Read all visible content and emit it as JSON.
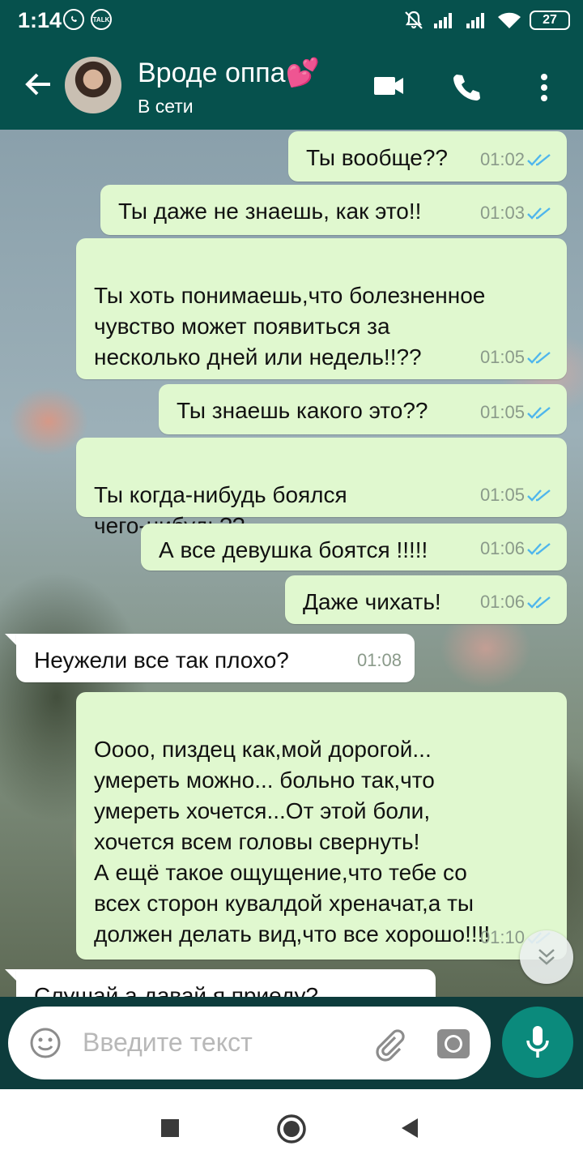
{
  "status_bar": {
    "time": "1:14",
    "talk_badge": "TALK",
    "battery": "27"
  },
  "header": {
    "contact_name": "Вроде оппа💕",
    "contact_status": "В сети"
  },
  "messages": [
    {
      "text": "Ты вообще??",
      "time": "01:02",
      "direction": "out"
    },
    {
      "text": "Ты даже не знаешь, как это!!",
      "time": "01:03",
      "direction": "out"
    },
    {
      "text": "Ты хоть понимаешь,что болезненное\nчувство может появиться за\nнесколько дней или недель!!??",
      "time": "01:05",
      "direction": "out"
    },
    {
      "text": "Ты знаешь какого это??",
      "time": "01:05",
      "direction": "out"
    },
    {
      "text": "Ты когда-нибудь боялся\nчего-нибудь??",
      "time": "01:05",
      "direction": "out"
    },
    {
      "text": "А все девушка боятся !!!!!",
      "time": "01:06",
      "direction": "out"
    },
    {
      "text": "Даже чихать!",
      "time": "01:06",
      "direction": "out"
    },
    {
      "text": "Неужели все так плохо?",
      "time": "01:08",
      "direction": "in"
    },
    {
      "text": "Оооо, пиздец как,мой дорогой...\nумереть можно... больно так,что\nумереть хочется...От этой боли,\nхочется всем головы свернуть!\nА ещё такое ощущение,что тебе со\nвсех сторон кувалдой хреначат,а ты\nдолжен делать вид,что все хорошо!!!!",
      "time": "01:10",
      "direction": "out"
    },
    {
      "text": "Слушай,а давай я приеду?",
      "time": "",
      "direction": "in"
    }
  ],
  "input": {
    "placeholder": "Введите текст"
  },
  "colors": {
    "header": "#06514d",
    "outgoing_bubble": "#e0f8cf",
    "incoming_bubble": "#ffffff",
    "read_ticks": "#4fb6ec",
    "mic_button": "#0b8a7c"
  },
  "icons": [
    "back-arrow-icon",
    "video-call-icon",
    "phone-icon",
    "more-vert-icon",
    "emoji-icon",
    "attach-icon",
    "camera-icon",
    "mic-icon",
    "scroll-down-icon"
  ]
}
